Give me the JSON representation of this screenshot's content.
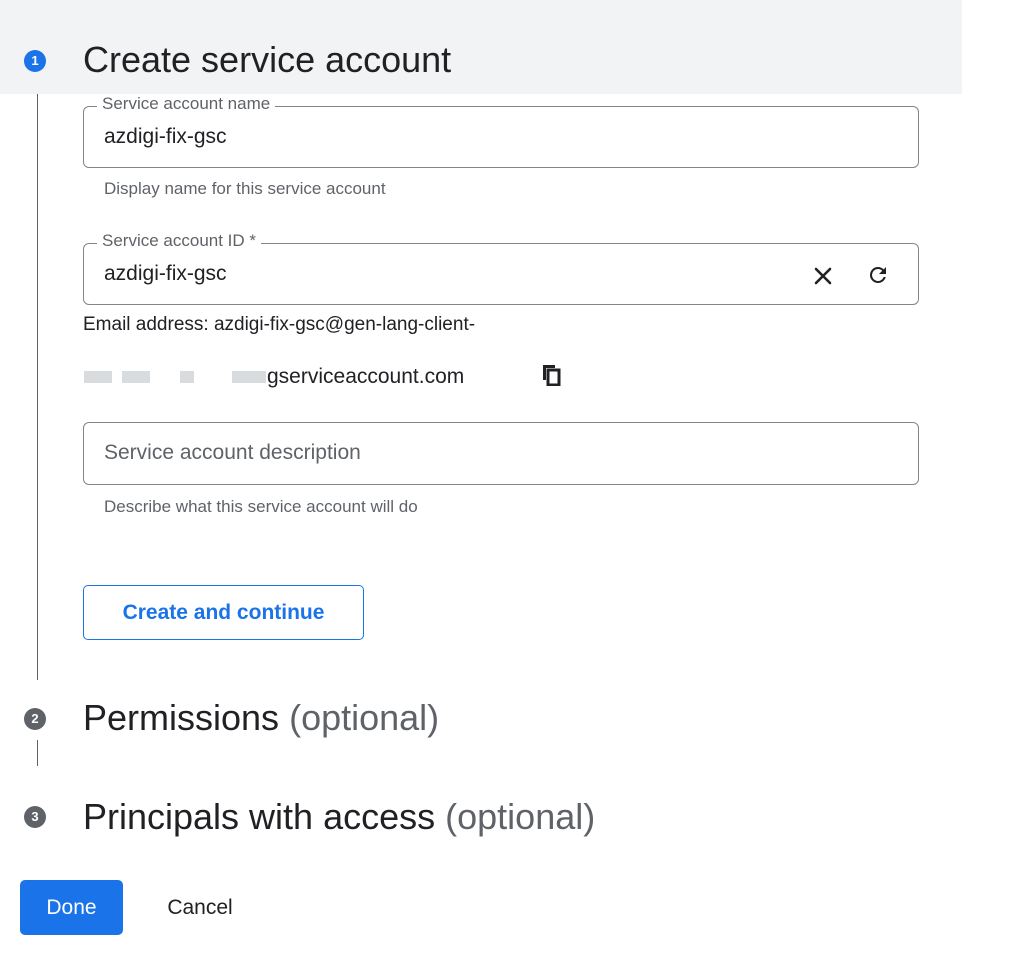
{
  "steps": [
    {
      "number": "1",
      "title": "Create service account",
      "optional": ""
    },
    {
      "number": "2",
      "title": "Permissions",
      "optional": "(optional)"
    },
    {
      "number": "3",
      "title": "Principals with access",
      "optional": "(optional)"
    }
  ],
  "form": {
    "name_field": {
      "label": "Service account name",
      "value": "azdigi-fix-gsc",
      "hint": "Display name for this service account"
    },
    "id_field": {
      "label": "Service account ID *",
      "value": "azdigi-fix-gsc",
      "clear_icon": "close-icon",
      "refresh_icon": "refresh-icon"
    },
    "email": {
      "line1": "Email address: azdigi-fix-gsc@gen-lang-client-",
      "line2": "gserviceaccount.com",
      "copy_icon": "copy-icon"
    },
    "description_field": {
      "placeholder": "Service account description",
      "hint": "Describe what this service account will do"
    },
    "create_button": "Create and continue"
  },
  "actions": {
    "done": "Done",
    "cancel": "Cancel"
  },
  "colors": {
    "accent": "#1a73e8",
    "inactive_step": "#5f6368",
    "header_band": "#f1f3f4"
  }
}
